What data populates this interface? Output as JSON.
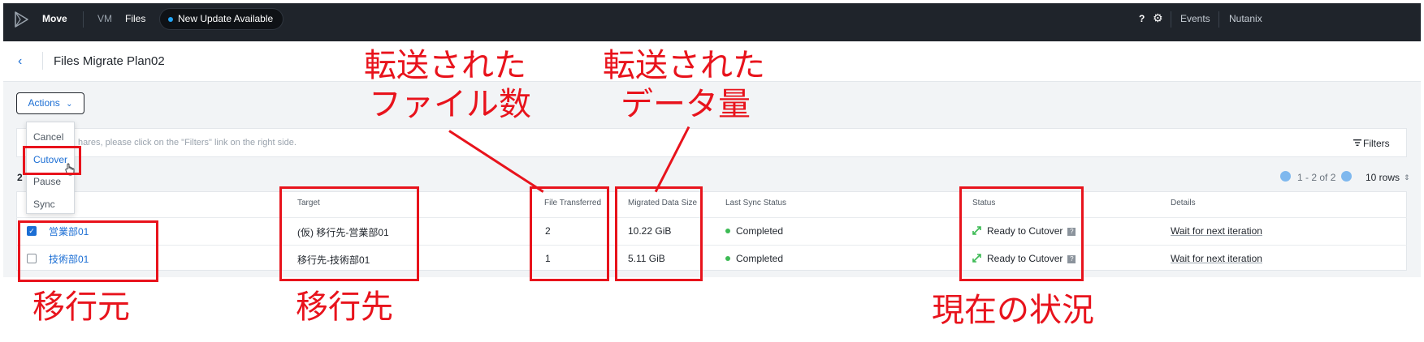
{
  "topbar": {
    "app_name": "Move",
    "nav_vm": "VM",
    "nav_files": "Files",
    "update_badge": "New Update Available",
    "help": "?",
    "settings": "⚙",
    "events": "Events",
    "user": "Nutanix"
  },
  "header": {
    "back": "‹",
    "title": "Files Migrate Plan02"
  },
  "toolbar": {
    "actions_label": "Actions",
    "actions_chevron": "⌄"
  },
  "actions_menu": {
    "items": [
      "Cancel",
      "Cutover",
      "Pause",
      "Sync"
    ],
    "selected": "Cutover"
  },
  "filter_bar": {
    "hint": "hares, please click on the \"Filters\" link on the right side.",
    "filters_link": "Filters"
  },
  "list": {
    "count": "2",
    "pagination": "1 - 2 of 2",
    "rows_per_page": "10 rows"
  },
  "table": {
    "columns": {
      "target": "Target",
      "files": "File Transferred",
      "size": "Migrated Data Size",
      "sync": "Last Sync Status",
      "status": "Status",
      "details": "Details"
    },
    "rows": [
      {
        "checked": true,
        "source": "営業部01",
        "target": "(仮) 移行先-営業部01",
        "files": "2",
        "size": "10.22 GiB",
        "sync": "Completed",
        "status": "Ready to Cutover",
        "details": "Wait for next iteration"
      },
      {
        "checked": false,
        "source": "技術部01",
        "target": "移行先-技術部01",
        "files": "1",
        "size": "5.11 GiB",
        "sync": "Completed",
        "status": "Ready to Cutover",
        "details": "Wait for next iteration"
      }
    ]
  },
  "annotations": {
    "files_transferred_1": "転送された",
    "files_transferred_2": "ファイル数",
    "data_amount_1": "転送された",
    "data_amount_2": "データ量",
    "source": "移行元",
    "target": "移行先",
    "status": "現在の状況"
  },
  "colors": {
    "annotation_red": "#e8131c",
    "accent_blue": "#1b6ed4",
    "topbar_bg": "#1f242b",
    "success_green": "#3cba54"
  }
}
